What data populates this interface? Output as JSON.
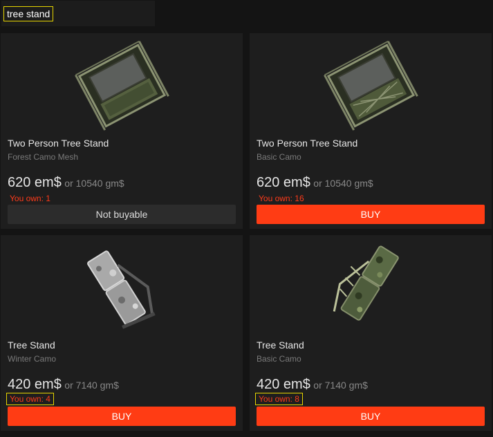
{
  "search": {
    "query": "tree stand"
  },
  "items": [
    {
      "name": "Two Person Tree Stand",
      "variant": "Forest Camo Mesh",
      "price_em": "620 em$",
      "price_gm": "or 10540 gm$",
      "owned": "You own: 1",
      "button_label": "Not buyable",
      "buyable": false,
      "image_icon": "two-person-tree-stand",
      "camo_color": "#55603f"
    },
    {
      "name": "Two Person Tree Stand",
      "variant": "Basic Camo",
      "price_em": "620 em$",
      "price_gm": "or 10540 gm$",
      "owned": "You own: 16",
      "button_label": "BUY",
      "buyable": true,
      "image_icon": "two-person-tree-stand",
      "camo_color": "#4f5a3a"
    },
    {
      "name": "Tree Stand",
      "variant": "Winter Camo",
      "price_em": "420 em$",
      "price_gm": "or 7140 gm$",
      "owned": "You own: 4",
      "button_label": "BUY",
      "buyable": true,
      "image_icon": "tree-stand",
      "camo_color": "#a9a9a9"
    },
    {
      "name": "Tree Stand",
      "variant": "Basic Camo",
      "price_em": "420 em$",
      "price_gm": "or 7140 gm$",
      "owned": "You own: 8",
      "button_label": "BUY",
      "buyable": true,
      "image_icon": "tree-stand",
      "camo_color": "#5a6a45"
    }
  ],
  "colors": {
    "accent": "#ff3c14",
    "owned_text": "#ff3b1a",
    "highlight": "#e6d400",
    "card_bg": "#1e1e1e",
    "page_bg": "#141414"
  }
}
